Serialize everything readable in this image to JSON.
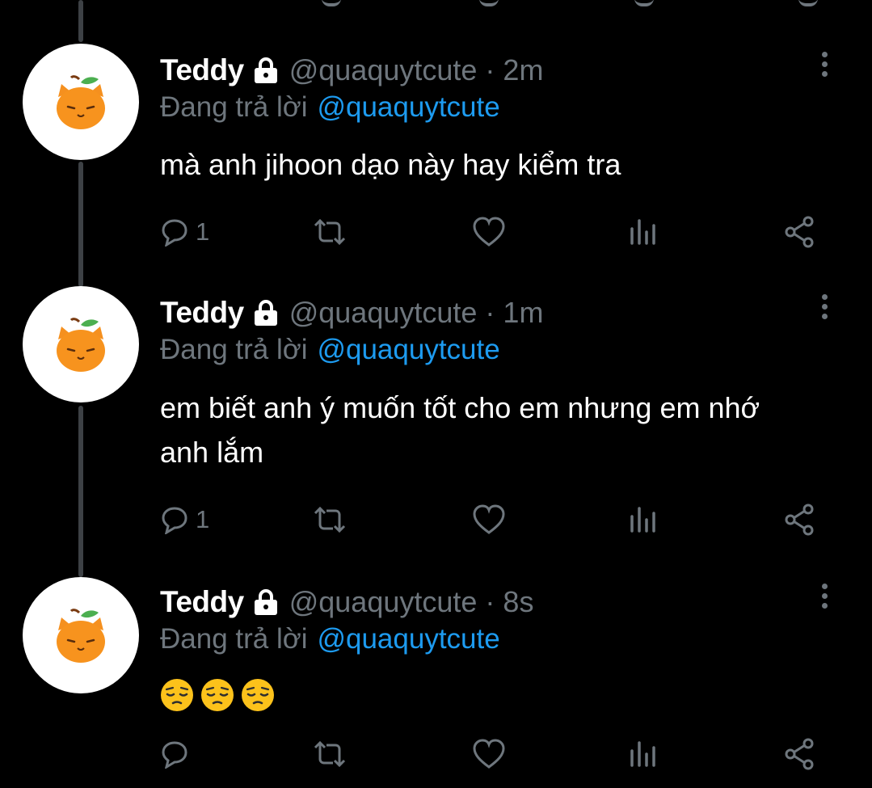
{
  "colors": {
    "background": "#000000",
    "text": "#ffffff",
    "muted": "#6e767d",
    "link": "#1d9bf0",
    "thread_line": "#3d4145"
  },
  "tweets": [
    {
      "name": "Teddy",
      "handle": "@quaquytcute",
      "separator": "·",
      "time": "2m",
      "reply_prefix": "Đang trả lời",
      "reply_to": "@quaquytcute",
      "text": "mà anh jihoon dạo này hay kiểm tra",
      "reply_count": "1"
    },
    {
      "name": "Teddy",
      "handle": "@quaquytcute",
      "separator": "·",
      "time": "1m",
      "reply_prefix": "Đang trả lời",
      "reply_to": "@quaquytcute",
      "text_lines": [
        "em biết anh ý muốn tốt cho em nhưng em nhớ",
        "anh lắm"
      ],
      "reply_count": "1"
    },
    {
      "name": "Teddy",
      "handle": "@quaquytcute",
      "separator": "·",
      "time": "8s",
      "reply_prefix": "Đang trả lời",
      "reply_to": "@quaquytcute",
      "emoji": [
        "pensive-face",
        "pensive-face",
        "pensive-face"
      ],
      "reply_count": ""
    }
  ],
  "icons": {
    "avatar": "orange-cat-avatar",
    "lock": "lock-icon",
    "more": "vertical-ellipsis-icon",
    "reply": "reply-bubble-icon",
    "retweet": "retweet-icon",
    "like": "heart-icon",
    "views": "analytics-bars-icon",
    "share": "share-icon"
  }
}
